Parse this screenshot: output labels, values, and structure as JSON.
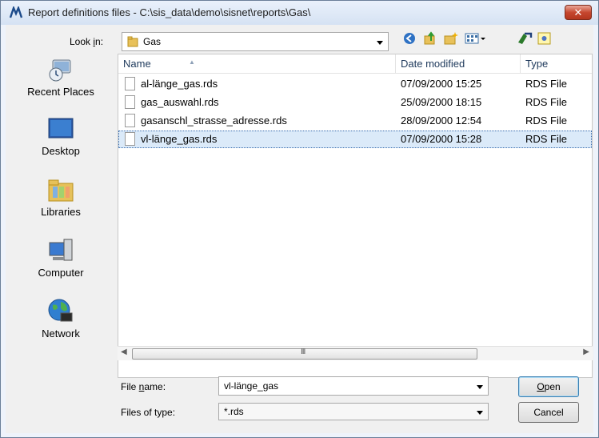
{
  "window": {
    "title": "Report definitions files - C:\\sis_data\\demo\\sisnet\\reports\\Gas\\",
    "close_glyph": "✕"
  },
  "lookin": {
    "label_pre": "Look ",
    "label_mn": "i",
    "label_post": "n:",
    "value": "Gas"
  },
  "places": [
    {
      "label": "Recent Places",
      "icon": "recent-places-icon"
    },
    {
      "label": "Desktop",
      "icon": "desktop-icon"
    },
    {
      "label": "Libraries",
      "icon": "libraries-icon"
    },
    {
      "label": "Computer",
      "icon": "computer-icon"
    },
    {
      "label": "Network",
      "icon": "network-icon"
    }
  ],
  "columns": {
    "name": "Name",
    "date": "Date modified",
    "type": "Type"
  },
  "files": [
    {
      "name": "al-länge_gas.rds",
      "date": "07/09/2000 15:25",
      "type": "RDS File"
    },
    {
      "name": "gas_auswahl.rds",
      "date": "25/09/2000 18:15",
      "type": "RDS File"
    },
    {
      "name": "gasanschl_strasse_adresse.rds",
      "date": "28/09/2000 12:54",
      "type": "RDS File"
    },
    {
      "name": "vl-länge_gas.rds",
      "date": "07/09/2000 15:28",
      "type": "RDS File",
      "selected": true
    }
  ],
  "scrollbar": {
    "grip": "III"
  },
  "filename": {
    "label_pre": "File ",
    "label_mn": "n",
    "label_post": "ame:",
    "value": "vl-länge_gas"
  },
  "filetype": {
    "label": "Files of type:",
    "value": "*.rds"
  },
  "buttons": {
    "open_mn": "O",
    "open_post": "pen",
    "cancel": "Cancel"
  }
}
